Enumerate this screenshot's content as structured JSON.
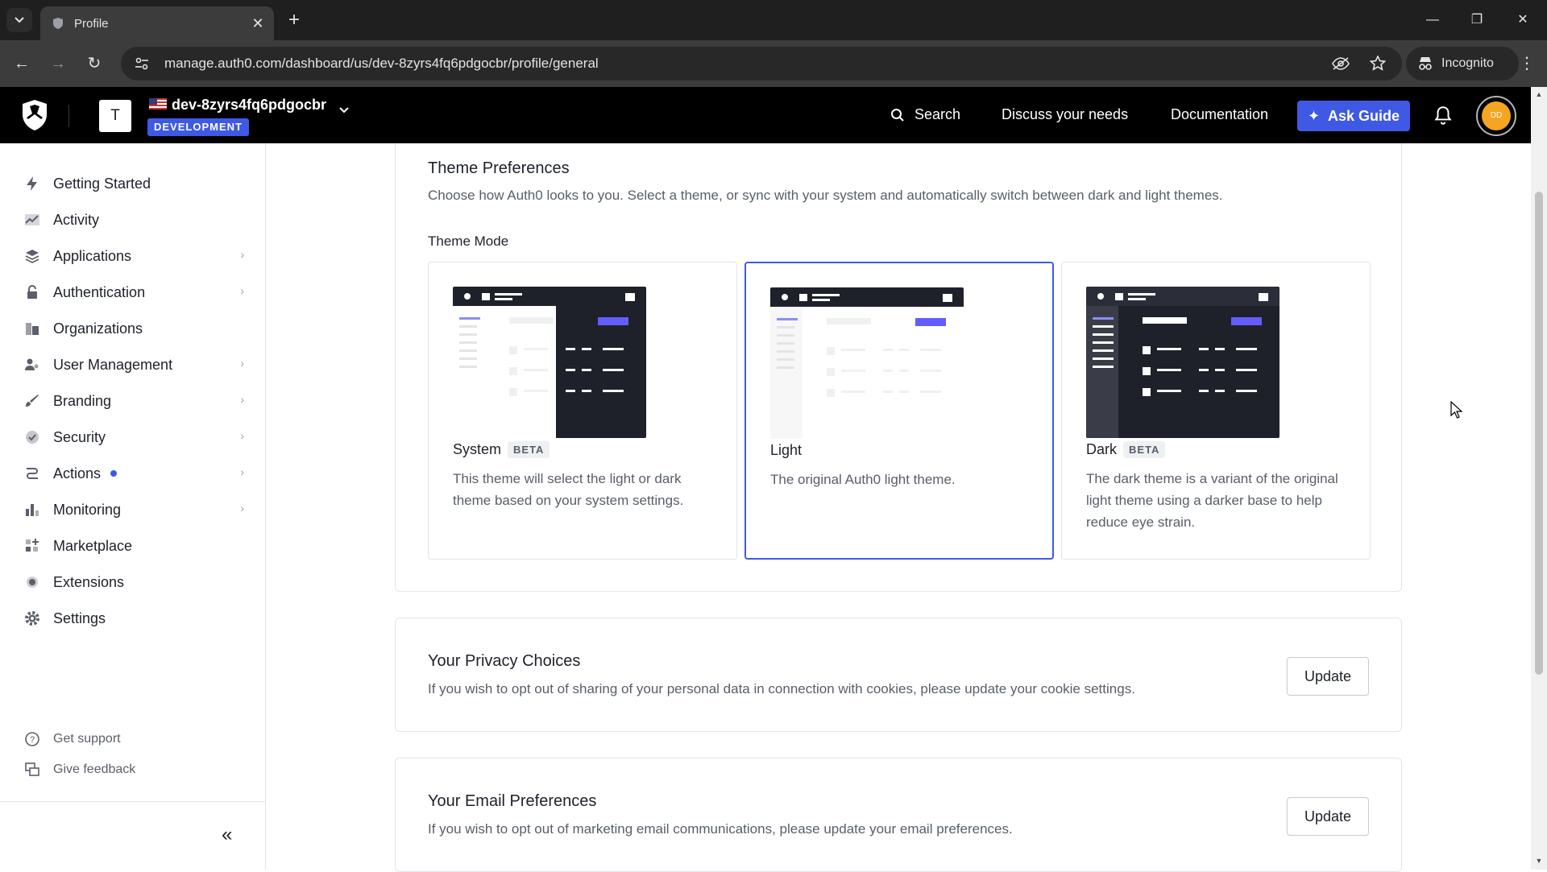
{
  "browser": {
    "tab_title": "Profile",
    "url": "manage.auth0.com/dashboard/us/dev-8zyrs4fq6pdgocbr/profile/general",
    "incognito_label": "Incognito"
  },
  "header": {
    "tenant_initial": "T",
    "tenant_name": "dev-8zyrs4fq6pdgocbr",
    "environment": "DEVELOPMENT",
    "search_label": "Search",
    "discuss_label": "Discuss your needs",
    "docs_label": "Documentation",
    "ask_guide_label": "Ask Guide",
    "user_initials": "DD",
    "accent_color": "#3f59e4"
  },
  "sidebar": {
    "items": [
      {
        "label": "Getting Started",
        "icon": "bolt-icon"
      },
      {
        "label": "Activity",
        "icon": "activity-chart-icon"
      },
      {
        "label": "Applications",
        "icon": "layers-icon"
      },
      {
        "label": "Authentication",
        "icon": "lock-icon"
      },
      {
        "label": "Organizations",
        "icon": "building-icon"
      },
      {
        "label": "User Management",
        "icon": "users-icon"
      },
      {
        "label": "Branding",
        "icon": "brush-icon"
      },
      {
        "label": "Security",
        "icon": "shield-check-icon"
      },
      {
        "label": "Actions",
        "icon": "actions-flow-icon"
      },
      {
        "label": "Monitoring",
        "icon": "bar-chart-icon"
      },
      {
        "label": "Marketplace",
        "icon": "grid-plus-icon"
      },
      {
        "label": "Extensions",
        "icon": "extension-icon"
      },
      {
        "label": "Settings",
        "icon": "gear-icon"
      }
    ],
    "get_support": "Get support",
    "give_feedback": "Give feedback"
  },
  "theme": {
    "title": "Theme Preferences",
    "description": "Choose how Auth0 looks to you. Select a theme, or sync with your system and automatically switch between dark and light themes.",
    "mode_label": "Theme Mode",
    "options": [
      {
        "name": "System",
        "badge": "BETA",
        "description": "This theme will select the light or dark theme based on your system settings."
      },
      {
        "name": "Light",
        "badge": "",
        "description": "The original Auth0 light theme."
      },
      {
        "name": "Dark",
        "badge": "BETA",
        "description": "The dark theme is a variant of the original light theme using a darker base to help reduce eye strain."
      }
    ],
    "selected": "Light"
  },
  "privacy": {
    "title": "Your Privacy Choices",
    "description": "If you wish to opt out of sharing of your personal data in connection with cookies, please update your cookie settings.",
    "button": "Update"
  },
  "email": {
    "title": "Your Email Preferences",
    "description": "If you wish to opt out of marketing email communications, please update your email preferences.",
    "button": "Update"
  }
}
